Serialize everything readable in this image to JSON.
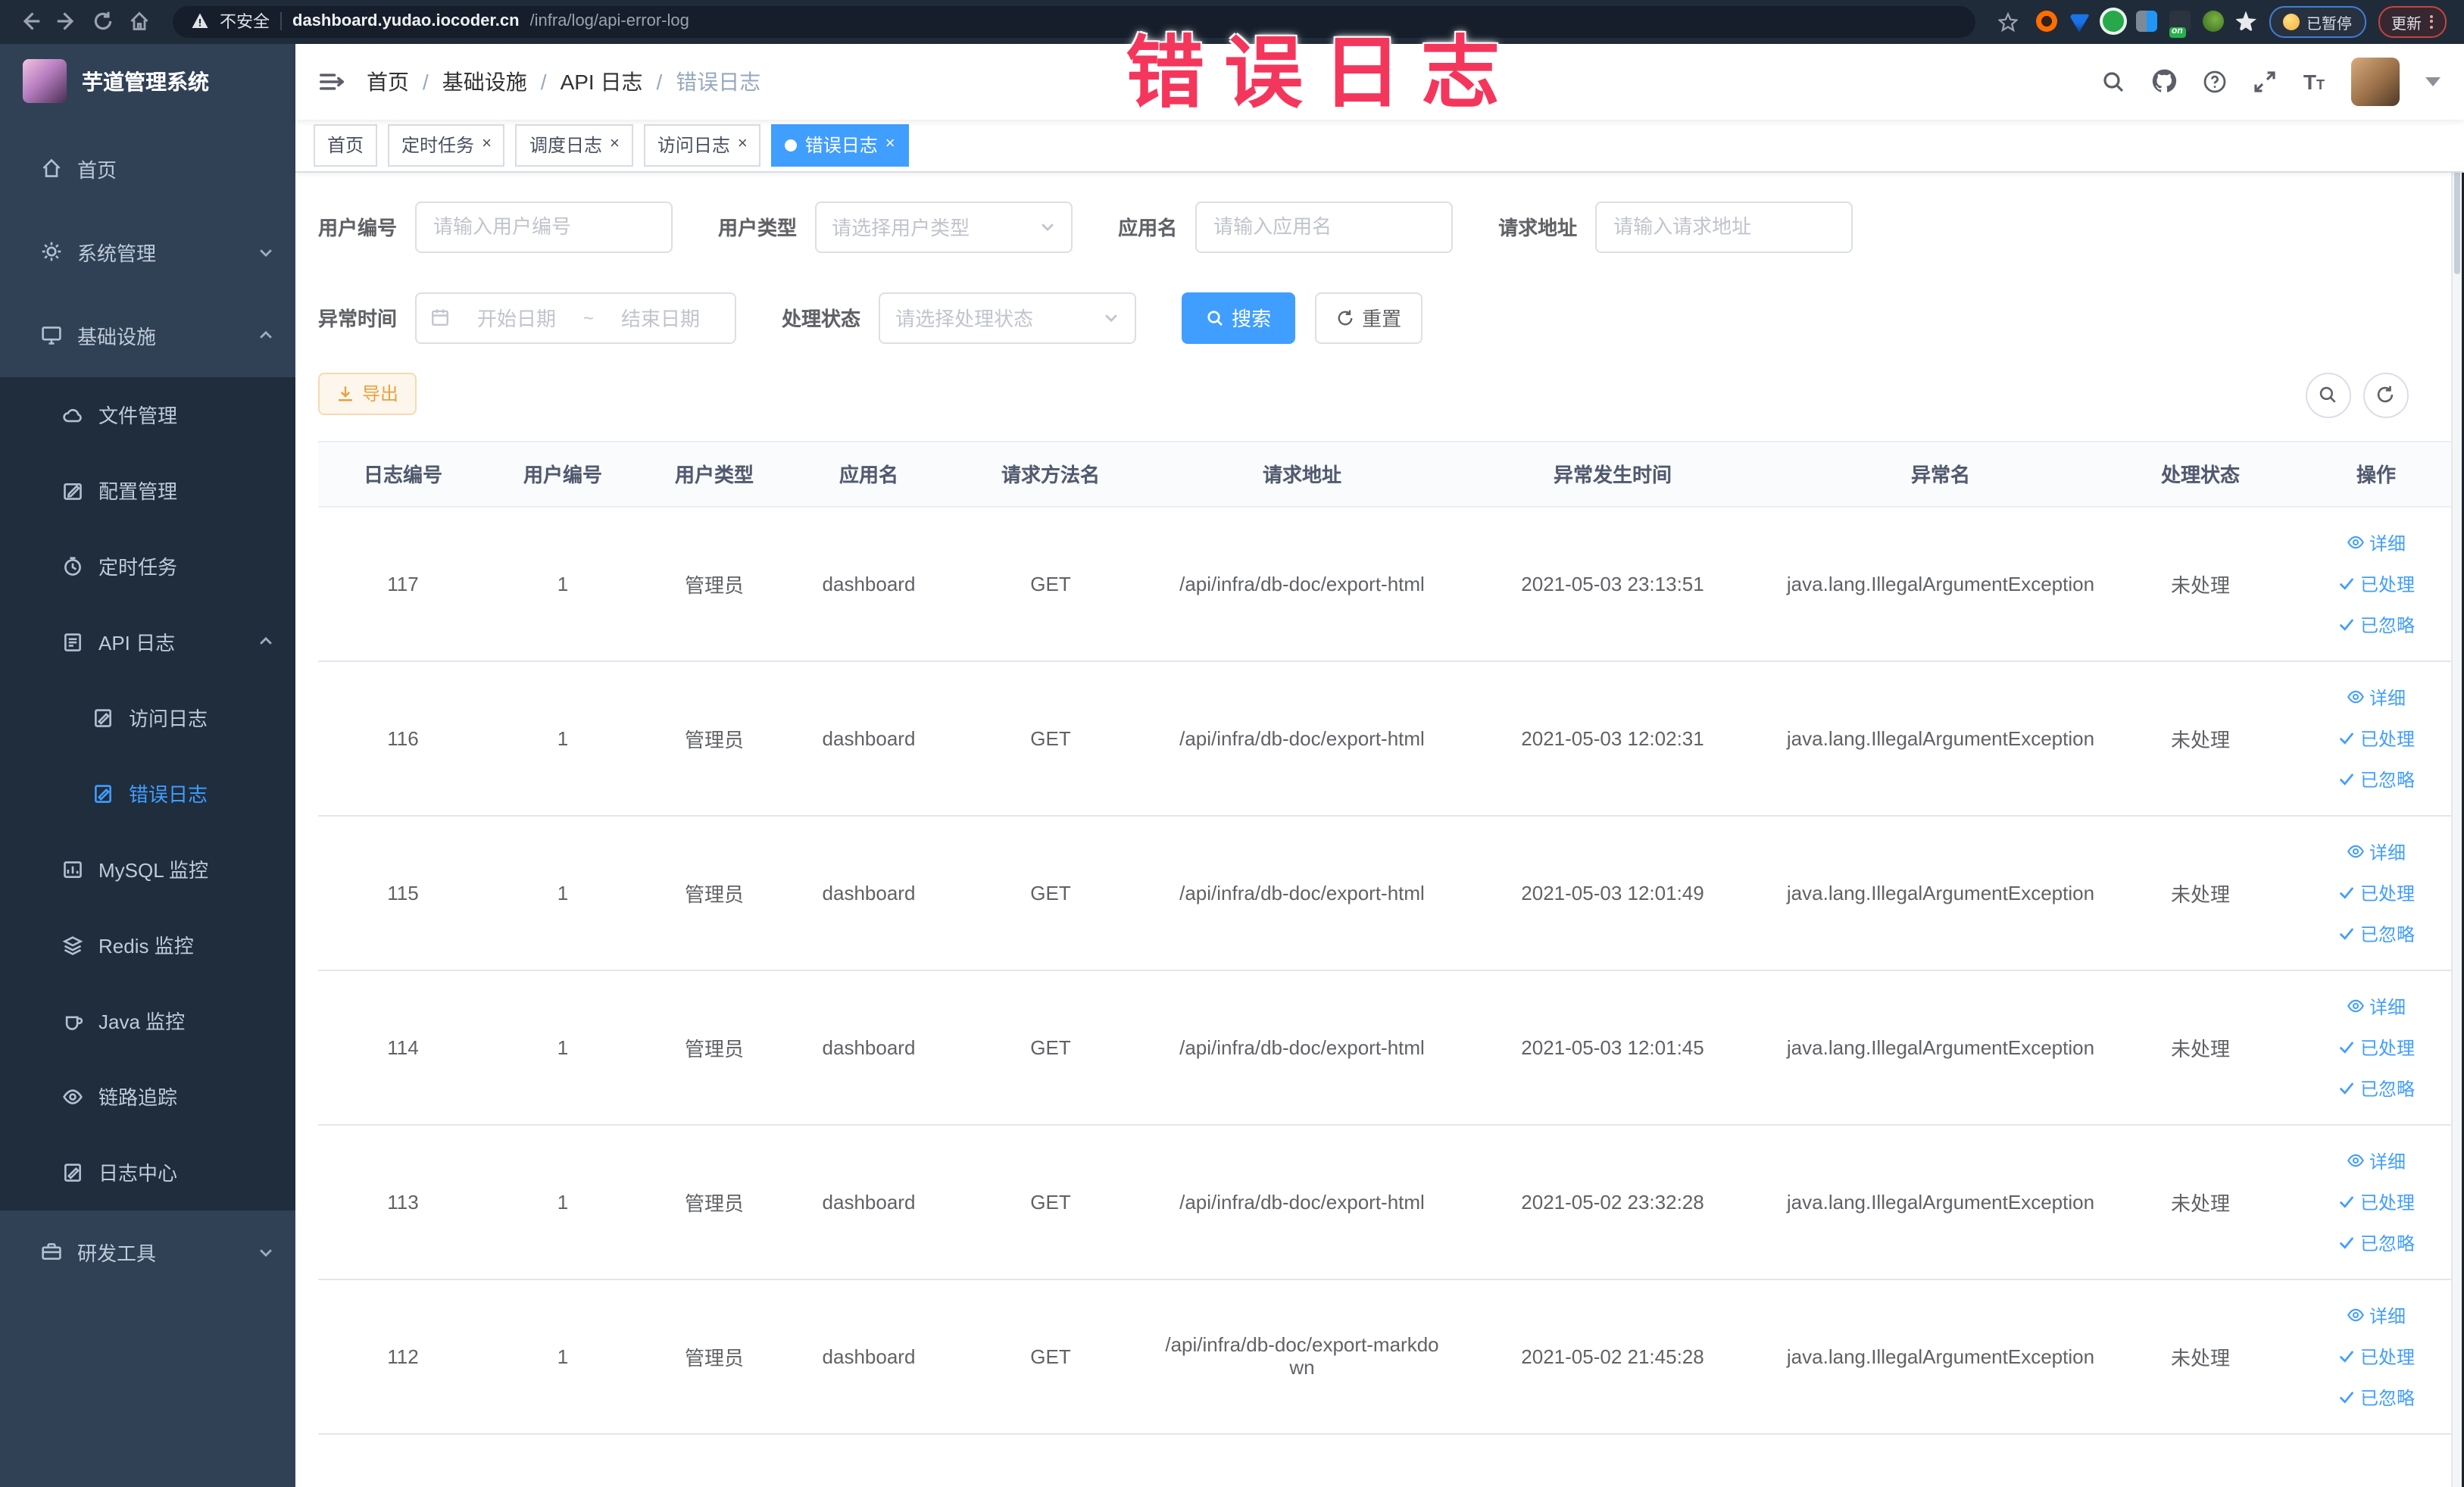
{
  "browser": {
    "security_label": "不安全",
    "url_host": "dashboard.yudao.iocoder.cn",
    "url_path": "/infra/log/api-error-log",
    "paused_badge": "已暂停",
    "update_button": "更新"
  },
  "sidebar": {
    "title": "芋道管理系统",
    "items": [
      {
        "label": "首页"
      },
      {
        "label": "系统管理"
      },
      {
        "label": "基础设施"
      },
      {
        "label": "文件管理"
      },
      {
        "label": "配置管理"
      },
      {
        "label": "定时任务"
      },
      {
        "label": "API 日志"
      },
      {
        "label": "访问日志"
      },
      {
        "label": "错误日志"
      },
      {
        "label": "MySQL 监控"
      },
      {
        "label": "Redis 监控"
      },
      {
        "label": "Java 监控"
      },
      {
        "label": "链路追踪"
      },
      {
        "label": "日志中心"
      },
      {
        "label": "研发工具"
      }
    ]
  },
  "navbar": {
    "breadcrumb": [
      "首页",
      "基础设施",
      "API 日志",
      "错误日志"
    ]
  },
  "tabs": [
    {
      "label": "首页"
    },
    {
      "label": "定时任务"
    },
    {
      "label": "调度日志"
    },
    {
      "label": "访问日志"
    },
    {
      "label": "错误日志"
    }
  ],
  "filters": {
    "user_id": {
      "label": "用户编号",
      "placeholder": "请输入用户编号",
      "value": ""
    },
    "user_type": {
      "label": "用户类型",
      "placeholder": "请选择用户类型"
    },
    "app_name": {
      "label": "应用名",
      "placeholder": "请输入应用名",
      "value": ""
    },
    "request_url": {
      "label": "请求地址",
      "placeholder": "请输入请求地址",
      "value": ""
    },
    "exception_time": {
      "label": "异常时间",
      "start_placeholder": "开始日期",
      "separator": "~",
      "end_placeholder": "结束日期"
    },
    "process_status": {
      "label": "处理状态",
      "placeholder": "请选择处理状态"
    },
    "search_button": "搜索",
    "reset_button": "重置"
  },
  "toolbar": {
    "export_button": "导出"
  },
  "table": {
    "headers": [
      "日志编号",
      "用户编号",
      "用户类型",
      "应用名",
      "请求方法名",
      "请求地址",
      "异常发生时间",
      "异常名",
      "处理状态",
      "操作"
    ],
    "actions": [
      "详细",
      "已处理",
      "已忽略"
    ],
    "rows": [
      {
        "log_id": "117",
        "user_id": "1",
        "user_type": "管理员",
        "app_name": "dashboard",
        "method": "GET",
        "url": "/api/infra/db-doc/export-html",
        "time": "2021-05-03 23:13:51",
        "exception": "java.lang.IllegalArgumentException",
        "status": "未处理"
      },
      {
        "log_id": "116",
        "user_id": "1",
        "user_type": "管理员",
        "app_name": "dashboard",
        "method": "GET",
        "url": "/api/infra/db-doc/export-html",
        "time": "2021-05-03 12:02:31",
        "exception": "java.lang.IllegalArgumentException",
        "status": "未处理"
      },
      {
        "log_id": "115",
        "user_id": "1",
        "user_type": "管理员",
        "app_name": "dashboard",
        "method": "GET",
        "url": "/api/infra/db-doc/export-html",
        "time": "2021-05-03 12:01:49",
        "exception": "java.lang.IllegalArgumentException",
        "status": "未处理"
      },
      {
        "log_id": "114",
        "user_id": "1",
        "user_type": "管理员",
        "app_name": "dashboard",
        "method": "GET",
        "url": "/api/infra/db-doc/export-html",
        "time": "2021-05-03 12:01:45",
        "exception": "java.lang.IllegalArgumentException",
        "status": "未处理"
      },
      {
        "log_id": "113",
        "user_id": "1",
        "user_type": "管理员",
        "app_name": "dashboard",
        "method": "GET",
        "url": "/api/infra/db-doc/export-html",
        "time": "2021-05-02 23:32:28",
        "exception": "java.lang.IllegalArgumentException",
        "status": "未处理"
      },
      {
        "log_id": "112",
        "user_id": "1",
        "user_type": "管理员",
        "app_name": "dashboard",
        "method": "GET",
        "url": "/api/infra/db-doc/export-markdown",
        "time": "2021-05-02 21:45:28",
        "exception": "java.lang.IllegalArgumentException",
        "status": "未处理"
      }
    ]
  },
  "overlay": {
    "annotation": "错误日志"
  },
  "colors": {
    "accent": "#409eff",
    "warning": "#e6a23c",
    "sidebar_bg": "#304156",
    "submenu_bg": "#1f2d3d",
    "annotation": "#f5365c",
    "browser_bar_bg": "#202b3a"
  }
}
